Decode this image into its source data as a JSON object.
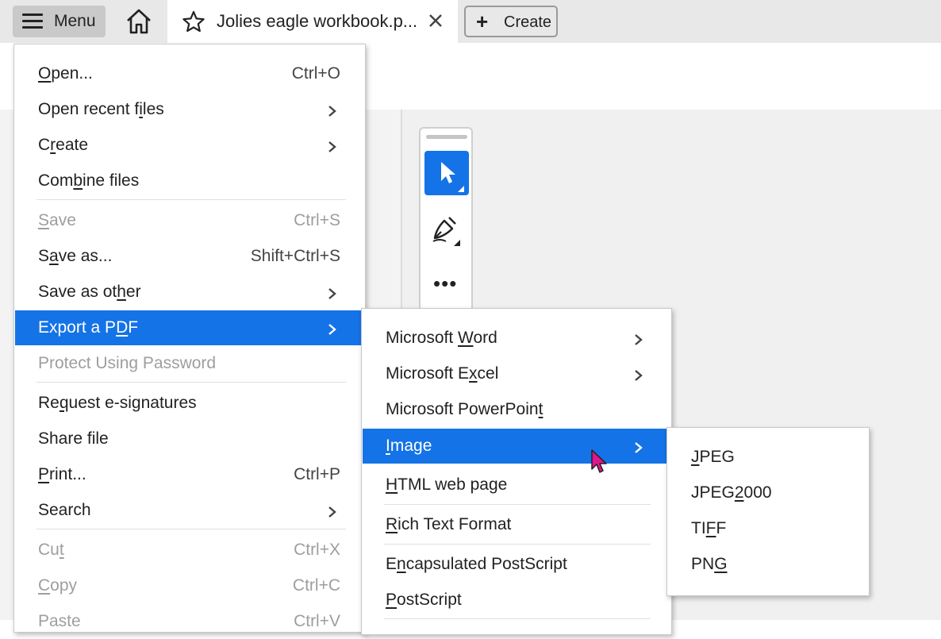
{
  "tabbar": {
    "menu_label": "Menu",
    "doc_title": "Jolies eagle workbook.p...",
    "create_label": "Create"
  },
  "colors": {
    "accent": "#1473e6",
    "cursor": "#e0148c"
  },
  "main_menu": {
    "items": [
      {
        "pre": "",
        "ul": "O",
        "post": "pen...",
        "shortcut": "Ctrl+O",
        "submenu": false,
        "disabled": false
      },
      {
        "pre": "Open recent f",
        "ul": "i",
        "post": "les",
        "shortcut": "",
        "submenu": true,
        "disabled": false
      },
      {
        "pre": "C",
        "ul": "r",
        "post": "eate",
        "shortcut": "",
        "submenu": true,
        "disabled": false
      },
      {
        "pre": "Com",
        "ul": "b",
        "post": "ine files",
        "shortcut": "",
        "submenu": false,
        "disabled": false
      },
      {
        "pre": "",
        "ul": "S",
        "post": "ave",
        "shortcut": "Ctrl+S",
        "submenu": false,
        "disabled": true
      },
      {
        "pre": "S",
        "ul": "a",
        "post": "ve as...",
        "shortcut": "Shift+Ctrl+S",
        "submenu": false,
        "disabled": false
      },
      {
        "pre": "Save as ot",
        "ul": "h",
        "post": "er",
        "shortcut": "",
        "submenu": true,
        "disabled": false
      },
      {
        "pre": "Export a P",
        "ul": "D",
        "post": "F",
        "shortcut": "",
        "submenu": true,
        "disabled": false
      },
      {
        "pre": "Protect Using Password",
        "ul": "",
        "post": "",
        "shortcut": "",
        "submenu": false,
        "disabled": true
      },
      {
        "pre": "Re",
        "ul": "q",
        "post": "uest e-signatures",
        "shortcut": "",
        "submenu": false,
        "disabled": false
      },
      {
        "pre": "Share file",
        "ul": "",
        "post": "",
        "shortcut": "",
        "submenu": false,
        "disabled": false
      },
      {
        "pre": "",
        "ul": "P",
        "post": "rint...",
        "shortcut": "Ctrl+P",
        "submenu": false,
        "disabled": false
      },
      {
        "pre": "Search",
        "ul": "",
        "post": "",
        "shortcut": "",
        "submenu": true,
        "disabled": false
      },
      {
        "pre": "Cu",
        "ul": "t",
        "post": "",
        "shortcut": "Ctrl+X",
        "submenu": false,
        "disabled": true
      },
      {
        "pre": "",
        "ul": "C",
        "post": "opy",
        "shortcut": "Ctrl+C",
        "submenu": false,
        "disabled": true
      },
      {
        "pre": "Paste",
        "ul": "",
        "post": "",
        "shortcut": "Ctrl+V",
        "submenu": false,
        "disabled": true
      }
    ]
  },
  "export_menu": {
    "items": [
      {
        "pre": "Microsoft ",
        "ul": "W",
        "post": "ord",
        "submenu": true
      },
      {
        "pre": "Microsoft E",
        "ul": "x",
        "post": "cel",
        "submenu": true
      },
      {
        "pre": "Microsoft PowerPoin",
        "ul": "t",
        "post": "",
        "submenu": false
      },
      {
        "pre": "",
        "ul": "I",
        "post": "mage",
        "submenu": true
      },
      {
        "pre": "",
        "ul": "H",
        "post": "TML web page",
        "submenu": false
      },
      {
        "pre": "",
        "ul": "R",
        "post": "ich Text Format",
        "submenu": false
      },
      {
        "pre": "E",
        "ul": "n",
        "post": "capsulated PostScript",
        "submenu": false
      },
      {
        "pre": "",
        "ul": "P",
        "post": "ostScript",
        "submenu": false
      }
    ]
  },
  "image_menu": {
    "items": [
      {
        "pre": "",
        "ul": "J",
        "post": "PEG"
      },
      {
        "pre": "JPEG",
        "ul": "2",
        "post": "000"
      },
      {
        "pre": "TI",
        "ul": "F",
        "post": "F"
      },
      {
        "pre": "PN",
        "ul": "G",
        "post": ""
      }
    ]
  }
}
